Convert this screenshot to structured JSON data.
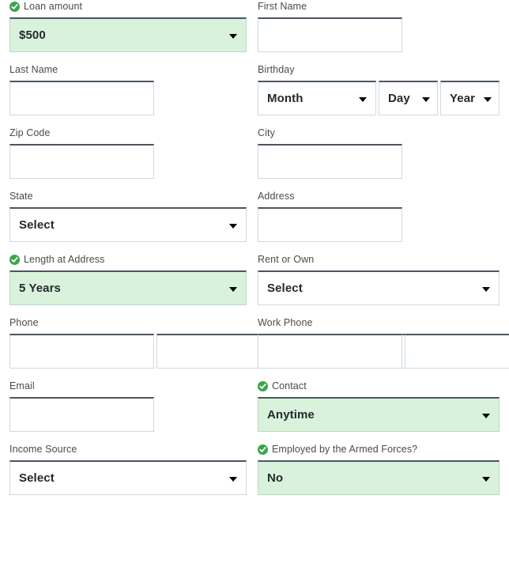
{
  "theme": {
    "filled_background": "#d9f2dc",
    "filled_border": "#bcd9bf",
    "field_border": "#cfd9e0",
    "field_top_border": "#4a5560",
    "label_color": "#4b4b4b",
    "value_color": "#24292e",
    "check_icon_color": "#3aa648"
  },
  "form": {
    "rows": [
      {
        "left": {
          "label": "Loan amount",
          "valid": true,
          "type": "select",
          "value": "$500",
          "filled": true
        },
        "right": {
          "label": "First Name",
          "valid": false,
          "type": "text",
          "value": "",
          "placeholder": ""
        }
      },
      {
        "left": {
          "label": "Last Name",
          "valid": false,
          "type": "text",
          "value": "",
          "placeholder": ""
        },
        "right": {
          "label": "Birthday",
          "valid": false,
          "type": "date-group",
          "parts": [
            {
              "value": "Month",
              "name": "birthday-month-select"
            },
            {
              "value": "Day",
              "name": "birthday-day-select"
            },
            {
              "value": "Year",
              "name": "birthday-year-select"
            }
          ]
        }
      },
      {
        "left": {
          "label": "Zip Code",
          "valid": false,
          "type": "text",
          "value": "",
          "placeholder": ""
        },
        "right": {
          "label": "City",
          "valid": false,
          "type": "text",
          "value": "",
          "placeholder": ""
        }
      },
      {
        "left": {
          "label": "State",
          "valid": false,
          "type": "select",
          "value": "Select",
          "filled": false
        },
        "right": {
          "label": "Address",
          "valid": false,
          "type": "text",
          "value": "",
          "placeholder": ""
        }
      },
      {
        "left": {
          "label": "Length at Address",
          "valid": true,
          "type": "select",
          "value": "5 Years",
          "filled": true
        },
        "right": {
          "label": "Rent or Own",
          "valid": false,
          "type": "select",
          "value": "Select",
          "filled": false
        }
      },
      {
        "left": {
          "label": "Phone",
          "valid": false,
          "type": "phone-group",
          "parts": [
            {
              "value": "",
              "name": "phone-area-code-input"
            },
            {
              "value": "",
              "name": "phone-prefix-input"
            },
            {
              "value": "",
              "name": "phone-line-number-input"
            }
          ]
        },
        "right": {
          "label": "Work Phone",
          "valid": false,
          "type": "phone-group",
          "parts": [
            {
              "value": "",
              "name": "work-phone-area-code-input"
            },
            {
              "value": "",
              "name": "work-phone-prefix-input"
            },
            {
              "value": "",
              "name": "work-phone-line-number-input"
            }
          ]
        }
      },
      {
        "left": {
          "label": "Email",
          "valid": false,
          "type": "text",
          "value": "",
          "placeholder": ""
        },
        "right": {
          "label": "Contact",
          "valid": true,
          "type": "select",
          "value": "Anytime",
          "filled": true
        }
      },
      {
        "left": {
          "label": "Income Source",
          "valid": false,
          "type": "select",
          "value": "Select",
          "filled": false
        },
        "right": {
          "label": "Employed by the Armed Forces?",
          "valid": true,
          "type": "select",
          "value": "No",
          "filled": true
        }
      }
    ]
  },
  "icons": {
    "valid_check": "check-circle-icon",
    "dropdown": "chevron-down-icon"
  }
}
